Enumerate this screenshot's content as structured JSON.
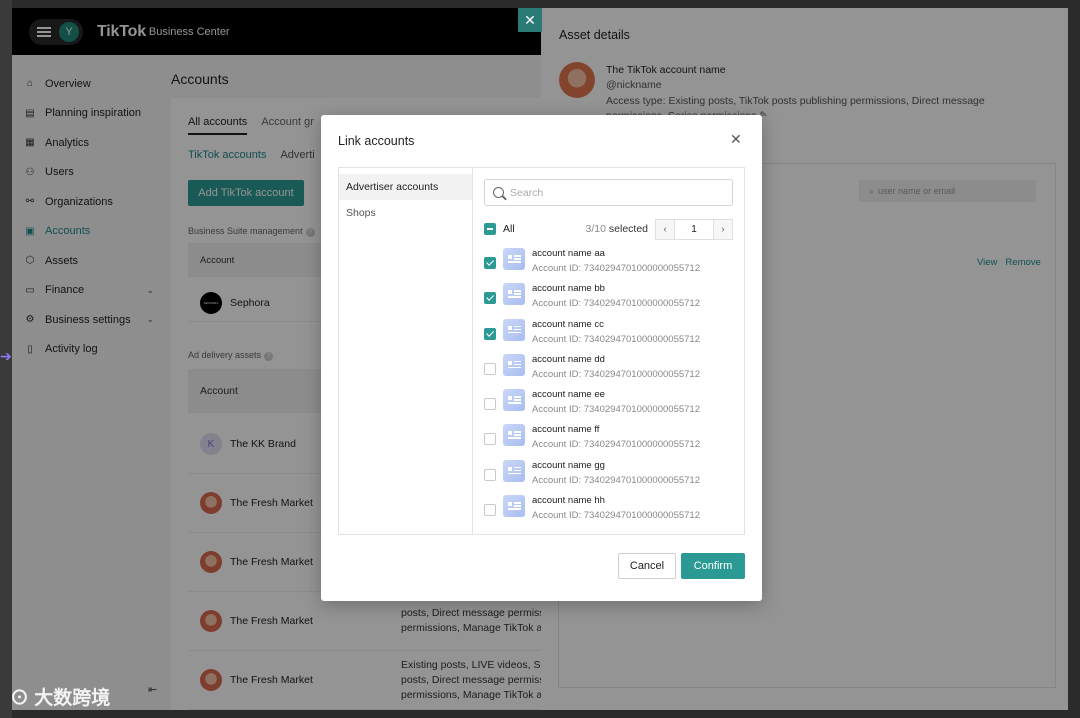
{
  "app": {
    "logo": "TikTok",
    "logo_sub": "Business Center",
    "avatar_initial": "Y"
  },
  "sidebar": {
    "items": [
      {
        "label": "Overview",
        "icon": "home-icon",
        "glyph": "⌂"
      },
      {
        "label": "Planning inspiration",
        "icon": "planning-icon",
        "glyph": "▤"
      },
      {
        "label": "Analytics",
        "icon": "analytics-icon",
        "glyph": "▦"
      },
      {
        "label": "Users",
        "icon": "users-icon",
        "glyph": "⚇"
      },
      {
        "label": "Organizations",
        "icon": "organizations-icon",
        "glyph": "⚯"
      },
      {
        "label": "Accounts",
        "icon": "accounts-icon",
        "glyph": "▣"
      },
      {
        "label": "Assets",
        "icon": "assets-icon",
        "glyph": "⬡"
      },
      {
        "label": "Finance",
        "icon": "finance-icon",
        "glyph": "▭"
      },
      {
        "label": "Business settings",
        "icon": "settings-icon",
        "glyph": "⚙"
      },
      {
        "label": "Activity log",
        "icon": "log-icon",
        "glyph": "▯"
      }
    ],
    "active": "Accounts"
  },
  "main": {
    "title": "Accounts",
    "tabs": [
      "All accounts",
      "Account gr"
    ],
    "subtabs": [
      "TikTok accounts",
      "Adverti"
    ],
    "add_button": "Add TikTok account",
    "section_bsm": "Business Suite management",
    "col_account": "Account",
    "bsm_row": "Sephora",
    "sephora_logo": "SEPHORA",
    "section_ada": "Ad delivery assets",
    "rows": [
      {
        "name": "The KK Brand",
        "initial": "K"
      },
      {
        "name": "The Fresh Market"
      },
      {
        "name": "The Fresh Market"
      },
      {
        "name": "The Fresh Market"
      },
      {
        "name": "The Fresh Market"
      }
    ],
    "perm_1": [
      "posts, Direct message permissio",
      "permissions, Manage TikTok acco"
    ],
    "perm_2": [
      "Existing posts, LIVE videos, Show",
      "posts, Direct message permissio",
      "permissions, Manage TikTok acco"
    ]
  },
  "drawer": {
    "title": "Asset details",
    "name": "The TikTok account name",
    "nickname": "@nickname",
    "access": "Access type: Existing posts, TikTok posts publishing permissions, Direct message permissions, Series permissions",
    "search_placeholder": "user name or email",
    "view": "View",
    "remove": "Remove"
  },
  "modal": {
    "title": "Link accounts",
    "left_items": [
      "Advertiser accounts",
      "Shops"
    ],
    "search_placeholder": "Search",
    "all_label": "All",
    "selected_count": "3/10",
    "selected_suffix": "selected",
    "page": "1",
    "accounts": [
      {
        "name": "account name aa",
        "id": "Account ID: 7340294701000000055712",
        "checked": true
      },
      {
        "name": "account name bb",
        "id": "Account ID: 7340294701000000055712",
        "checked": true
      },
      {
        "name": "account name cc",
        "id": "Account ID: 7340294701000000055712",
        "checked": true
      },
      {
        "name": "account name dd",
        "id": "Account ID: 7340294701000000055712",
        "checked": false
      },
      {
        "name": "account name ee",
        "id": "Account ID: 7340294701000000055712",
        "checked": false
      },
      {
        "name": "account name ff",
        "id": "Account ID: 7340294701000000055712",
        "checked": false
      },
      {
        "name": "account name gg",
        "id": "Account ID: 7340294701000000055712",
        "checked": false
      },
      {
        "name": "account name hh",
        "id": "Account ID: 7340294701000000055712",
        "checked": false
      }
    ],
    "cancel": "Cancel",
    "confirm": "Confirm"
  },
  "watermark": "大数跨境",
  "colors": {
    "accent": "#2c9a94",
    "link": "#1f8a8a"
  }
}
